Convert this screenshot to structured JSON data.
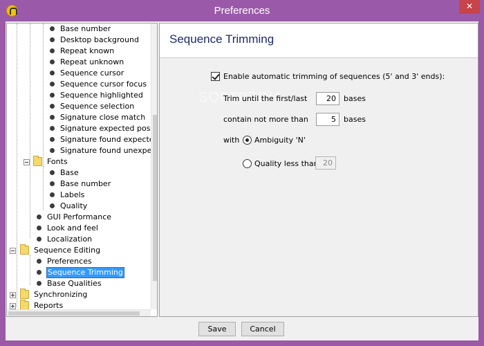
{
  "window": {
    "title": "Preferences",
    "close_glyph": "✕"
  },
  "tree": {
    "items": [
      {
        "label": "Base number"
      },
      {
        "label": "Desktop background"
      },
      {
        "label": "Repeat known"
      },
      {
        "label": "Repeat unknown"
      },
      {
        "label": "Sequence cursor"
      },
      {
        "label": "Sequence cursor focus"
      },
      {
        "label": "Sequence highlighted"
      },
      {
        "label": "Sequence selection"
      },
      {
        "label": "Signature close match"
      },
      {
        "label": "Signature expected position"
      },
      {
        "label": "Signature found expected"
      },
      {
        "label": "Signature found unexpected"
      },
      {
        "label": "Fonts"
      },
      {
        "label": "Base"
      },
      {
        "label": "Base number"
      },
      {
        "label": "Labels"
      },
      {
        "label": "Quality"
      },
      {
        "label": "GUI Performance"
      },
      {
        "label": "Look and feel"
      },
      {
        "label": "Localization"
      },
      {
        "label": "Sequence Editing"
      },
      {
        "label": "Preferences"
      },
      {
        "label": "Sequence Trimming"
      },
      {
        "label": "Base Qualities"
      },
      {
        "label": "Synchronizing"
      },
      {
        "label": "Reports"
      }
    ],
    "selected": "Sequence Trimming"
  },
  "content": {
    "title": "Sequence Trimming",
    "enable_label": "Enable automatic trimming of sequences (5' and 3' ends):",
    "enable_checked": true,
    "trim_label": "Trim until the first/last",
    "trim_value": "20",
    "trim_unit": "bases",
    "contain_label": "contain not more than",
    "contain_value": "5",
    "contain_unit": "bases",
    "with_label": "with",
    "ambiguity_label": "Ambiguity 'N'",
    "ambiguity_selected": true,
    "quality_label": "Quality less than",
    "quality_value": "20",
    "watermark": "SOFTPEDIA"
  },
  "buttons": {
    "save": "Save",
    "cancel": "Cancel"
  },
  "colors": {
    "titlebar": "#9b5aa9",
    "selection": "#3399ff",
    "header_title": "#1b2a6b"
  }
}
